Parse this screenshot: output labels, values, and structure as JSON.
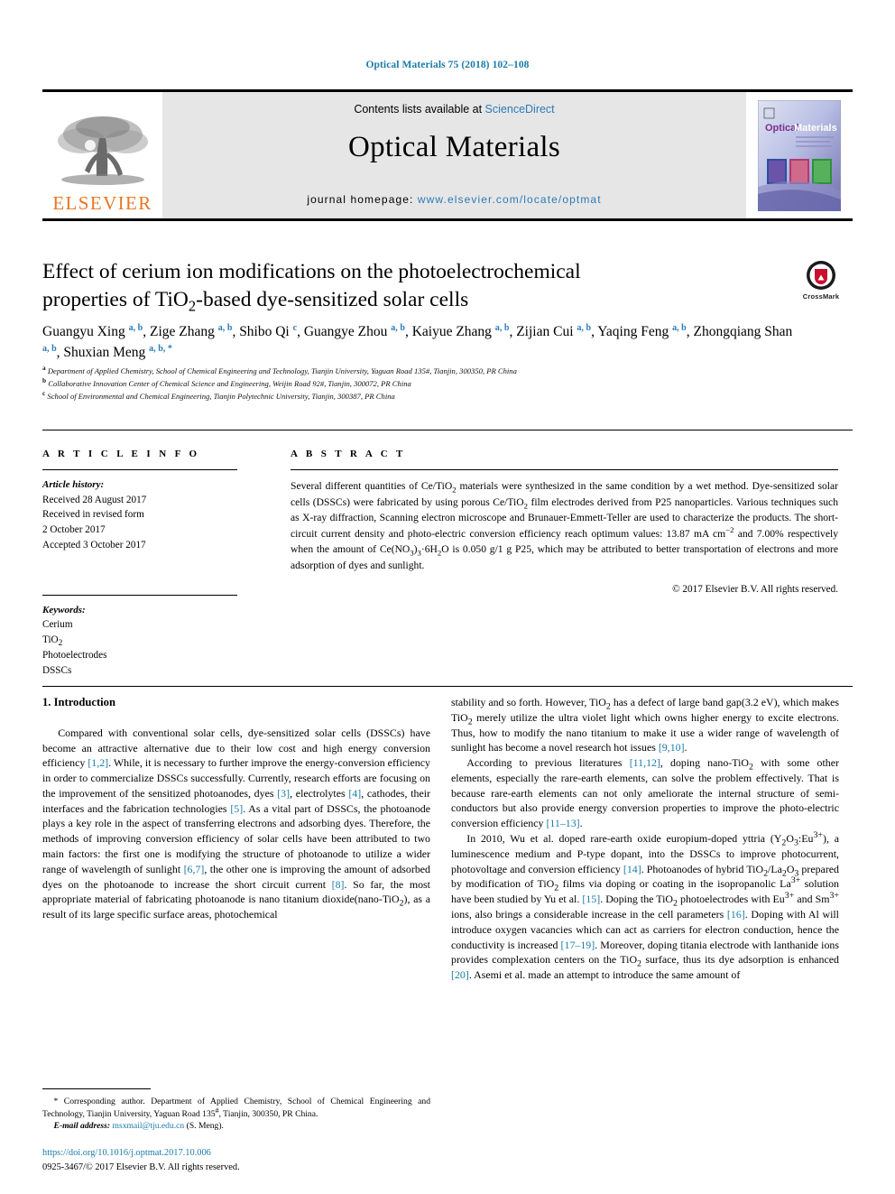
{
  "running_head": "Optical Materials 75 (2018) 102–108",
  "masthead": {
    "publisher_logo_text": "ELSEVIER",
    "contents_prefix": "Contents lists available at ",
    "contents_link": "ScienceDirect",
    "journal_name": "Optical Materials",
    "homepage_prefix": "journal homepage: ",
    "homepage_url": "www.elsevier.com/locate/optmat",
    "cover_title_1": "Optical",
    "cover_title_2": "Materials",
    "accent_color": "#2b7bb9",
    "elsevier_orange": "#E87722"
  },
  "article": {
    "title_line1": "Effect of cerium ion modifications on the photoelectrochemical",
    "title_line2_pre": "properties of TiO",
    "title_line2_sub": "2",
    "title_line2_post": "-based dye-sensitized solar cells",
    "crossmark_label": "CrossMark",
    "authors": [
      {
        "name": "Guangyu Xing",
        "marks": "a, b",
        "sep": ", "
      },
      {
        "name": "Zige Zhang",
        "marks": "a, b",
        "sep": ", "
      },
      {
        "name": "Shibo Qi",
        "marks": "c",
        "sep": ", "
      },
      {
        "name": "Guangye Zhou",
        "marks": "a, b",
        "sep": ", "
      },
      {
        "name": "Kaiyue Zhang",
        "marks": "a, b",
        "sep": ", "
      },
      {
        "name": "Zijian Cui",
        "marks": "a, b",
        "sep": ", "
      },
      {
        "name": "Yaqing Feng",
        "marks": "a, b",
        "sep": ", "
      },
      {
        "name": "Zhongqiang Shan",
        "marks": "a, b",
        "sep": ", "
      },
      {
        "name": "Shuxian Meng",
        "marks": "a, b, *",
        "sep": ""
      }
    ],
    "affiliations": [
      {
        "mark": "a",
        "text": "Department of Applied Chemistry, School of Chemical Engineering and Technology, Tianjin University, Yaguan Road 135#, Tianjin, 300350, PR China"
      },
      {
        "mark": "b",
        "text": "Collaborative Innovation Center of Chemical Science and Engineering, Weijin Road 92#, Tianjin, 300072, PR China"
      },
      {
        "mark": "c",
        "text": "School of Environmental and Chemical Engineering, Tianjin Polytechnic University, Tianjin, 300387, PR China"
      }
    ]
  },
  "article_info": {
    "heading": "A R T I C L E   I N F O",
    "history_label": "Article history:",
    "history_lines": [
      "Received 28 August 2017",
      "Received in revised form",
      "2 October 2017",
      "Accepted 3 October 2017"
    ],
    "keywords_label": "Keywords:",
    "keywords": [
      "Cerium",
      "TiO2",
      "Photoelectrodes",
      "DSSCs"
    ]
  },
  "abstract": {
    "heading": "A B S T R A C T",
    "body": "Several different quantities of Ce/TiO2 materials were synthesized in the same condition by a wet method. Dye-sensitized solar cells (DSSCs) were fabricated by using porous Ce/TiO2 film electrodes derived from P25 nanoparticles. Various techniques such as X-ray diffraction, Scanning electron microscope and Brunauer-Emmett-Teller are used to characterize the products. The short-circuit current density and photo-electric conversion efficiency reach optimum values: 13.87 mA cm−2 and 7.00% respectively when the amount of Ce(NO3)3·6H2O is 0.050 g/1 g P25, which may be attributed to better transportation of electrons and more adsorption of dyes and sunlight.",
    "copyright": "© 2017 Elsevier B.V. All rights reserved."
  },
  "body": {
    "section_number_title": "1.  Introduction",
    "left_paragraph_1": "Compared with conventional solar cells, dye-sensitized solar cells (DSSCs) have become an attractive alternative due to their low cost and high energy conversion efficiency [1,2]. While, it is necessary to further improve the energy-conversion efficiency in order to commercialize DSSCs successfully. Currently, research efforts are focusing on the improvement of the sensitized photoanodes, dyes [3], electrolytes [4], cathodes, their interfaces and the fabrication technologies [5]. As a vital part of DSSCs, the photoanode plays a key role in the aspect of transferring electrons and adsorbing dyes. Therefore, the methods of improving conversion efficiency of solar cells have been attributed to two main factors: the first one is modifying the structure of photoanode to utilize a wider range of wavelength of sunlight [6,7], the other one is improving the amount of adsorbed dyes on the photoanode to increase the short circuit current [8]. So far, the most appropriate material of fabricating photoanode is nano titanium dioxide(nano-TiO2), as a result of its large specific surface areas, photochemical",
    "right_paragraph_1": "stability and so forth. However, TiO2 has a defect of large band gap(3.2 eV), which makes TiO2 merely utilize the ultra violet light which owns higher energy to excite electrons. Thus, how to modify the nano titanium to make it use a wider range of wavelength of sunlight has become a novel research hot issues [9,10].",
    "right_paragraph_2": "According to previous literatures [11,12], doping nano-TiO2 with some other elements, especially the rare-earth elements, can solve the problem effectively. That is because rare-earth elements can not only ameliorate the internal structure of semi-conductors but also provide energy conversion properties to improve the photo-electric conversion efficiency [11–13].",
    "right_paragraph_3": "In 2010, Wu et al. doped rare-earth oxide europium-doped yttria (Y2O3:Eu3+), a luminescence medium and P-type dopant, into the DSSCs to improve photocurrent, photovoltage and conversion efficiency [14]. Photoanodes of hybrid TiO2/La2O3 prepared by modification of TiO2 films via doping or coating in the isopropanolic La3+ solution have been studied by Yu et al. [15]. Doping the TiO2 photoelectrodes with Eu3+ and Sm3+ ions, also brings a considerable increase in the cell parameters [16]. Doping with Al will introduce oxygen vacancies which can act as carriers for electron conduction, hence the conductivity is increased [17–19]. Moreover, doping titania electrode with lanthanide ions provides complexation centers on the TiO2 surface, thus its dye adsorption is enhanced [20]. Asemi et al. made an attempt to introduce the same amount of"
  },
  "footnote": {
    "corresponding": "* Corresponding author. Department of Applied Chemistry, School of Chemical Engineering and Technology, Tianjin University, Yaguan Road 135#, Tianjin, 300350, PR China.",
    "email_label": "E-mail address:",
    "email": "msxmail@tju.edu.cn",
    "email_owner": "(S. Meng)."
  },
  "doi_block": {
    "doi_url": "https://doi.org/10.1016/j.optmat.2017.10.006",
    "issn_line": "0925-3467/© 2017 Elsevier B.V. All rights reserved."
  }
}
